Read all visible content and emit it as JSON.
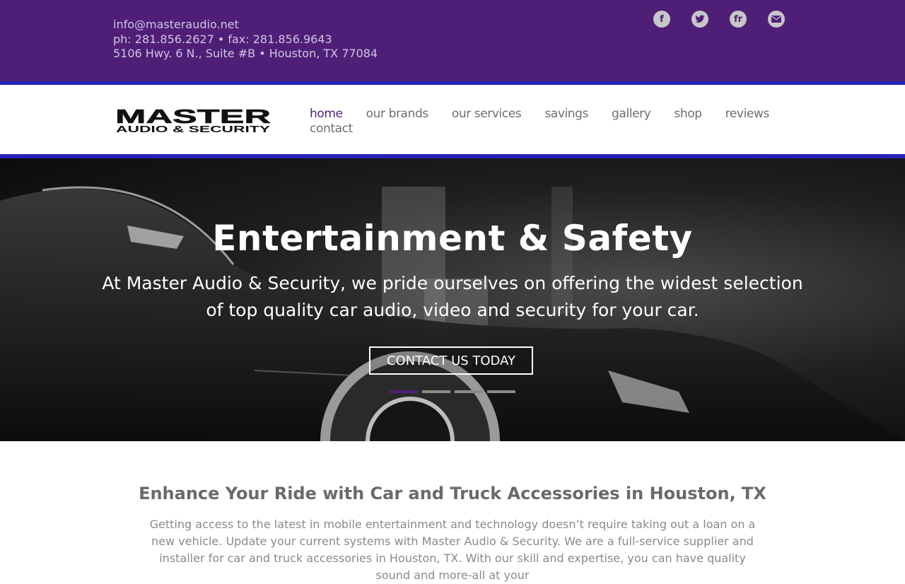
{
  "topbar": {
    "email": "info@masteraudio.net",
    "phone_fax": "ph: 281.856.2627 • fax: 281.856.9643",
    "address": "5106 Hwy. 6 N., Suite #B • Houston, TX 77084",
    "social": [
      {
        "name": "facebook-icon",
        "glyph": "f"
      },
      {
        "name": "twitter-icon"
      },
      {
        "name": "friendfeed-icon",
        "glyph": "fr"
      },
      {
        "name": "email-icon"
      }
    ]
  },
  "logo": {
    "line1": "MASTER",
    "line2": "AUDIO & SECURITY"
  },
  "nav": {
    "items": [
      {
        "label": "home",
        "active": true
      },
      {
        "label": "our brands"
      },
      {
        "label": "our services"
      },
      {
        "label": "savings"
      },
      {
        "label": "gallery"
      },
      {
        "label": "shop"
      },
      {
        "label": "reviews"
      },
      {
        "label": "contact"
      }
    ]
  },
  "hero": {
    "title": "Entertainment & Safety",
    "subtitle": "At Master Audio & Security, we pride ourselves on offering the widest selection of top quality car audio, video and security for your car.",
    "button": "CONTACT US TODAY",
    "slides_total": 4,
    "slide_active": 1
  },
  "intro": {
    "heading": "Enhance Your Ride with Car and Truck Accessories in Houston, TX",
    "body": "Getting access to the latest in mobile entertainment and technology doesn’t require taking out a loan on a new vehicle. Update your current systems with Master Audio & Security. We are a full-service supplier and installer for car and truck accessories in Houston, TX. With our skill and expertise, you can have quality sound and more-all at your"
  },
  "colors": {
    "brand_purple": "#4f1f78",
    "accent_blue": "#2323b5",
    "nav_text": "#6e6e6e"
  }
}
